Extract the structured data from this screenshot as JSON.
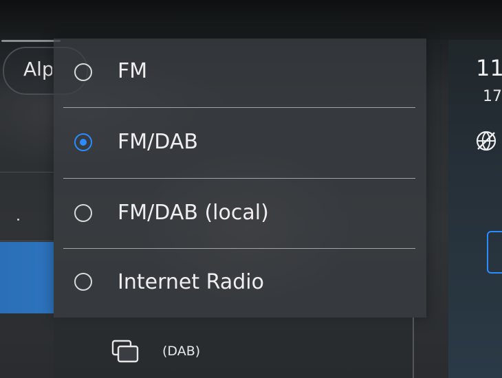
{
  "search": {
    "text": "Alp"
  },
  "source_menu": {
    "options": [
      {
        "label": "FM",
        "selected": false
      },
      {
        "label": "FM/DAB",
        "selected": true
      },
      {
        "label": "FM/DAB (local)",
        "selected": false
      },
      {
        "label": "Internet Radio",
        "selected": false
      }
    ]
  },
  "bottom_bar": {
    "band_label": "(DAB)",
    "icon": "stack-icon"
  },
  "status": {
    "time": "11",
    "date": "17",
    "icon": "globe-icon"
  },
  "colors": {
    "accent": "#2a8cff",
    "highlight": "#2e73bd"
  }
}
